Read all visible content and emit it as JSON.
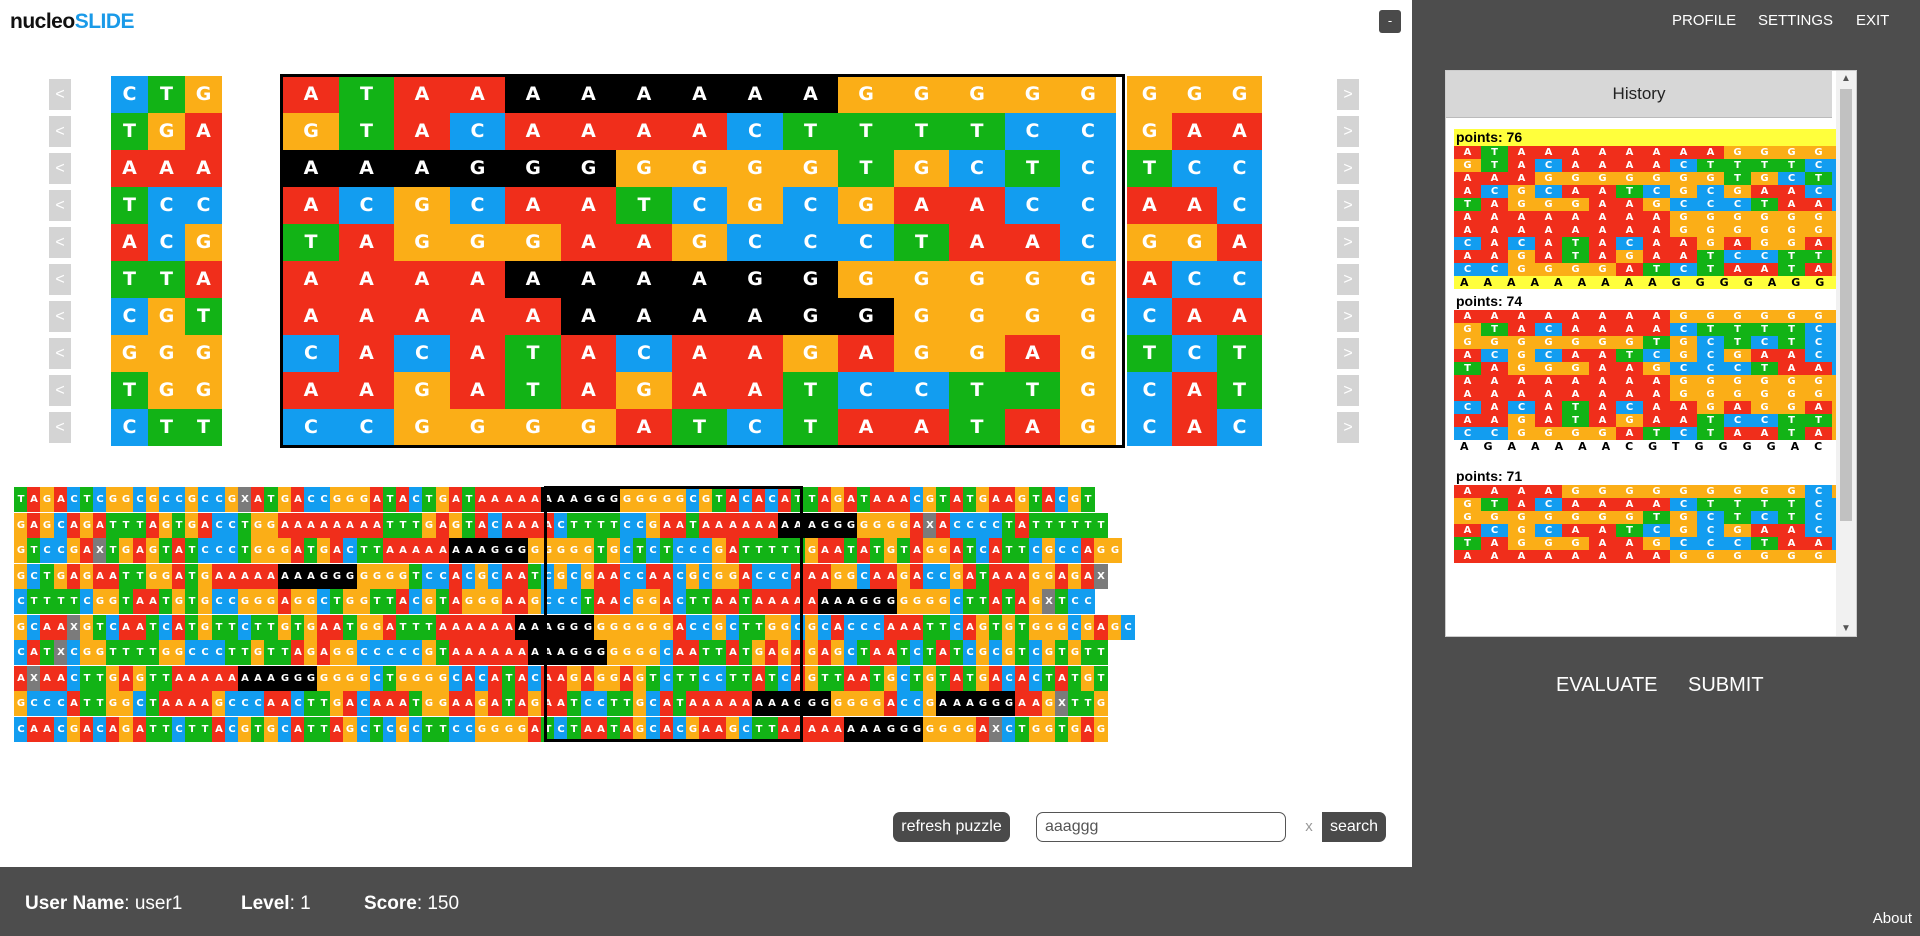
{
  "logo": {
    "part1": "nucleo",
    "part2": "SLIDE"
  },
  "minimize_label": "-",
  "nav": {
    "profile": "PROFILE",
    "settings": "SETTINGS",
    "exit": "EXIT"
  },
  "arrows": {
    "left": "<",
    "right": ">"
  },
  "puzzle": {
    "left": [
      "CTG",
      "TGA",
      "AAA",
      "TCC",
      "ACG",
      "TTA",
      "CGT",
      "GGG",
      "TGG",
      "CTT"
    ],
    "center": [
      "ATAAAAAAAAGGGGG",
      "GTACAAAACTTTTCC",
      "AAAGGGGGGGTGCTC",
      "ACGCAATCGCGAACC",
      "TAGGGAAGCCCTAAC",
      "AAAAAAAAGGGGGGG",
      "AAAAAAAAAGGGGGG",
      "CACATACAAGAGGAG",
      "AAGATAGAATCCTTG",
      "CCGGGGATCTAATAG"
    ],
    "center_black": [
      [
        4,
        9
      ],
      [],
      [
        0,
        5
      ],
      [],
      [],
      [
        4,
        9
      ],
      [
        5,
        10
      ],
      [],
      [],
      []
    ],
    "right": [
      "GGG",
      "GAA",
      "TCC",
      "AAC",
      "GGA",
      "ACC",
      "CAA",
      "TCT",
      "CAT",
      "CAC"
    ]
  },
  "genome": [
    "TAGACTCGGCGCCGCCGXATGACCGGGATACTGATAAAAAAAAGGGGGGGGCGTACACATTAGATAAACGTATGAAGTACGT",
    "GAGCAGATTTAGTGACCTGGAAAAAAAATTTGAGTACAAAACTTTTCCGAATAAAAAAAAAGGGGGGGAXACCCCTATTTTTT",
    "GTCCGAXTGAGTATCCCTGGGATGACTTAAAAAAAAGGGGGGGGTGCTCTCCCGATTTTTGAATATGTAGGATCATTCGCCAGG",
    "GCTGAGAATTGGATGAAAAAAAAGGGGGGGTCCACGCAATCGCGAACCAACGCGGACCCAAAGGCAAGACCGATAAAGGAGAX",
    "CTTTTCGGTAATGTGCCGGGAGGCTGGTTACGTAGGGAAGCCCTAACGGACTTAATAAAAAAAAGGGGGGGCTTATAGXTCC",
    "GCAAXGTCAATCATGTTCTTGTGAATGGATTTAAAAAAAAAGGGGGGGGGACCGCTTGGCGCACCCAAATTCAGTGTGGGCGAGC",
    "CATXCGGTTTTGGCCCTTGTTAGAGGCCCCCGTAAAAAAAAAGGGGGGGCAATTATGAGAGAGCTAATCTATCGCGTCGTGTT",
    "AXAACTTGAGTTAAAAAAAAGGGGGGGCTGGGGCACATACAAGAGGAGTCTTCCTTATCAGTTAATGCTGTATGACACTATGT",
    "GCCCATTGGCTAAAAGCCCAACTTGACAAATGGAAGATAGAATCCTTGCATAAAAAAAAGGGGGGGACCGAAAGGGAAGXTTG",
    "CAACGACAGATTCTTACGTGCATTAGCTCGCTTCCGGGGATCTAATAGCACGAAGCTTAAAAAAAAGGGGGGGAXCTGGTGAG"
  ],
  "history": {
    "title": "History",
    "entries": [
      {
        "points": "points: 76",
        "rows": [
          "ATAAAAAAAAGGGGG",
          "GTACAAAACTTTTCC",
          "AAAGGGGGGGTGCTC",
          "ACGCAATCGCGAACC",
          "TAGGGAAGCCCTAAC",
          "AAAAAAAAGGGGGGG",
          "AAAAAAAAGGGGGGG",
          "CACATACAAGAGGAG",
          "AAGATAGAATCCTTG",
          "CCGGGGATCTAATAG"
        ],
        "consensus": "AAAAAAAAAGGGGAGG"
      },
      {
        "points": "points: 74",
        "rows": [
          "AAAAAAAAGGGGGGG",
          "GTACAAAACTTTTCC",
          "GGGGGGGTGCTCTCC",
          "ACGCAATCGCGAACC",
          "TAGGGAAGCCCTAAC",
          "AAAAAAAAGGGGGGG",
          "AAAAAAAAGGGGGGG",
          "CACATACAAGAGGAG",
          "AAGATAGAATCCTTG",
          "CCGGGGATCTAATAG"
        ],
        "consensus": "AGAAAAACGTGGGGACG"
      },
      {
        "points": "points: 71",
        "rows": [
          "AAAAGGGGGGGGGCG",
          "GTACAAAACTTTTCC",
          "GGGGGGGTGCTCTCC",
          "ACGCAATCGCGAACC",
          "TAGGGAAGCCCTAAC",
          "AAAAAAAAGGGGGGG"
        ],
        "consensus": ""
      }
    ]
  },
  "actions": {
    "evaluate": "EVALUATE",
    "submit": "SUBMIT"
  },
  "controls": {
    "refresh": "refresh puzzle",
    "search_value": "aaaggg",
    "clear": "x",
    "search": "search"
  },
  "status": {
    "user_label": "User Name",
    "user_value": ": user1",
    "level_label": "Level",
    "level_value": ": 1",
    "score_label": "Score",
    "score_value": ": 150"
  },
  "about": "About",
  "colors": {
    "A": "#f02e1b",
    "C": "#129df0",
    "G": "#fbae17",
    "T": "#12b316",
    "X": "#7b7b7b",
    "match": "#000000",
    "panel": "#4d4d4d",
    "brand": "#1a9ae8"
  }
}
